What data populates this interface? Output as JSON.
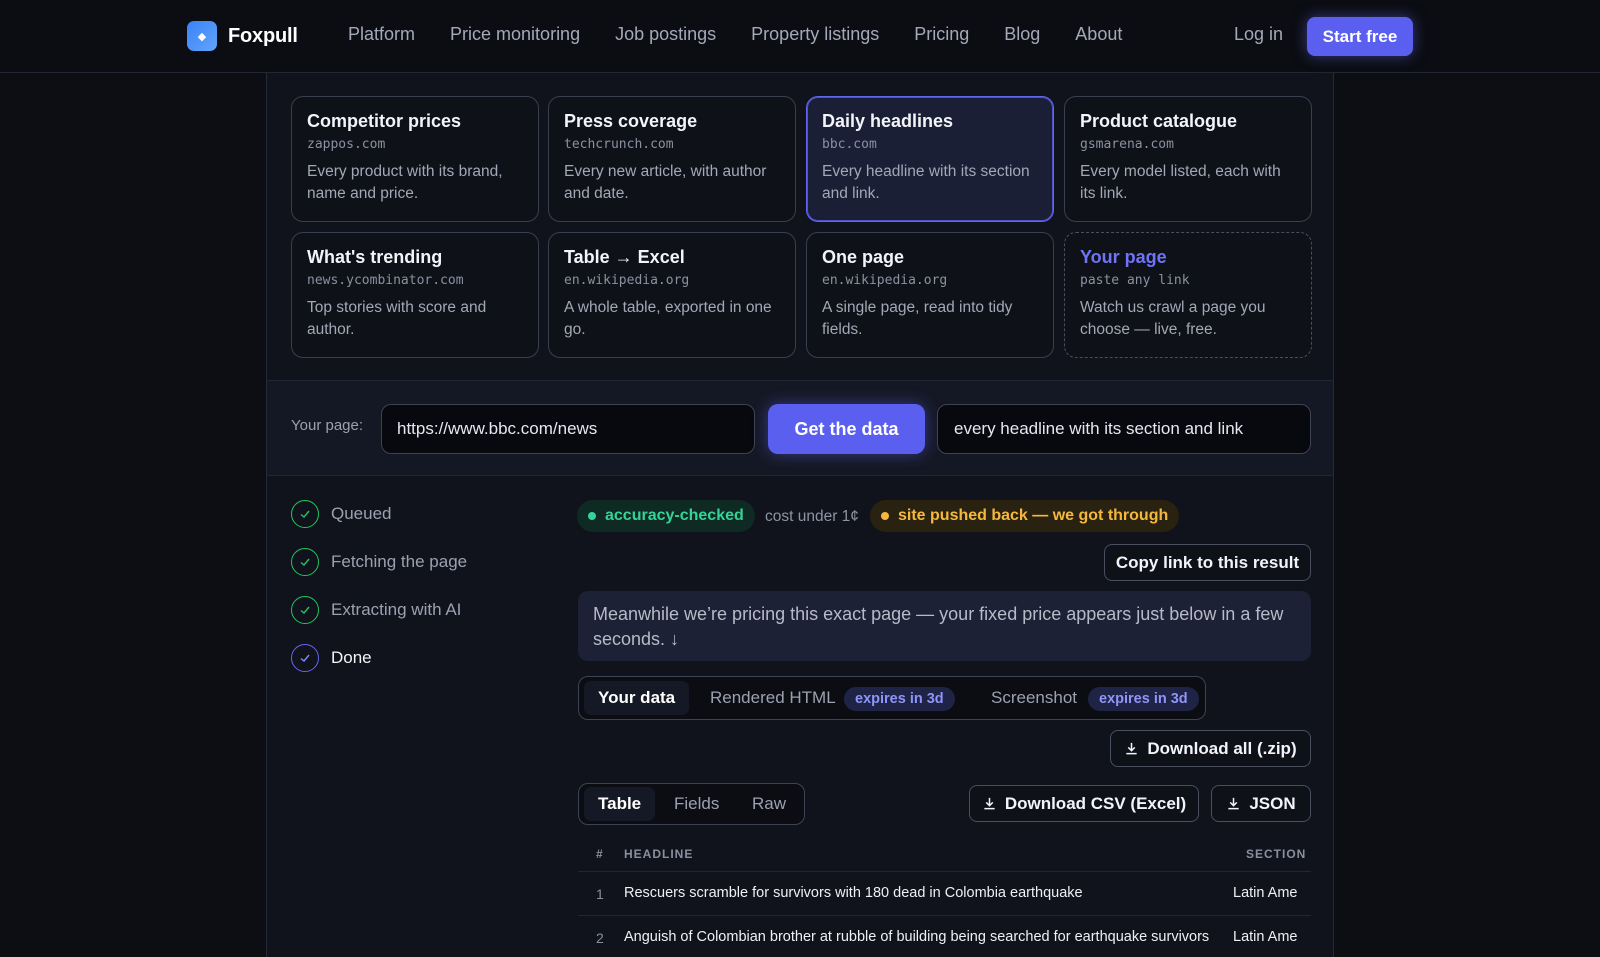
{
  "nav": {
    "brand": "Foxpull",
    "links": [
      "Platform",
      "Price monitoring",
      "Job postings",
      "Property listings",
      "Pricing",
      "Blog",
      "About"
    ],
    "login": "Log in",
    "start": "Start free"
  },
  "cards": [
    {
      "title": "Competitor prices",
      "domain": "zappos.com",
      "desc": "Every product with its brand, name and price."
    },
    {
      "title": "Press coverage",
      "domain": "techcrunch.com",
      "desc": "Every new article, with author and date."
    },
    {
      "title": "Daily headlines",
      "domain": "bbc.com",
      "desc": "Every headline with its section and link."
    },
    {
      "title": "Product catalogue",
      "domain": "gsmarena.com",
      "desc": "Every model listed, each with its link."
    },
    {
      "title": "What's trending",
      "domain": "news.ycombinator.com",
      "desc": "Top stories with score and author."
    },
    {
      "title": "Table → Excel",
      "domain": "en.wikipedia.org",
      "desc": "A whole table, exported in one go."
    },
    {
      "title": "One page",
      "domain": "en.wikipedia.org",
      "desc": "A single page, read into tidy fields."
    },
    {
      "title": "Your page",
      "domain": "paste any link",
      "desc": "Watch us crawl a page you choose — live, free."
    }
  ],
  "form": {
    "label": "Your page:",
    "url": "https://www.bbc.com/news",
    "submit": "Get the data",
    "description": "every headline with its section and link"
  },
  "steps": [
    "Queued",
    "Fetching the page",
    "Extracting with AI",
    "Done"
  ],
  "status": {
    "accuracy": "accuracy-checked",
    "cost": "cost under 1¢",
    "pushback": "site pushed back — we got through",
    "copy_link": "Copy link to this result",
    "note": "Meanwhile we’re pricing this exact page — your fixed price appears just below in a few seconds. ↓"
  },
  "tabs": {
    "your_data": "Your data",
    "rendered_html": "Rendered HTML",
    "rendered_expiry": "expires in 3d",
    "screenshot": "Screenshot",
    "screenshot_expiry": "expires in 3d"
  },
  "download_all": "Download all (.zip)",
  "subtabs": [
    "Table",
    "Fields",
    "Raw"
  ],
  "download_csv": "Download CSV (Excel)",
  "download_json": "JSON",
  "table": {
    "headers": [
      "#",
      "HEADLINE",
      "SECTION"
    ],
    "rows": [
      {
        "n": "1",
        "headline": "Rescuers scramble for survivors with 180 dead in Colombia earthquake",
        "section": "Latin Ame"
      },
      {
        "n": "2",
        "headline": "Anguish of Colombian brother at rubble of building being searched for earthquake survivors",
        "section": "Latin Ame"
      }
    ]
  },
  "colors": {
    "accent": "#5a5ff0",
    "success": "#22c55e",
    "warning": "#f5b83d"
  }
}
